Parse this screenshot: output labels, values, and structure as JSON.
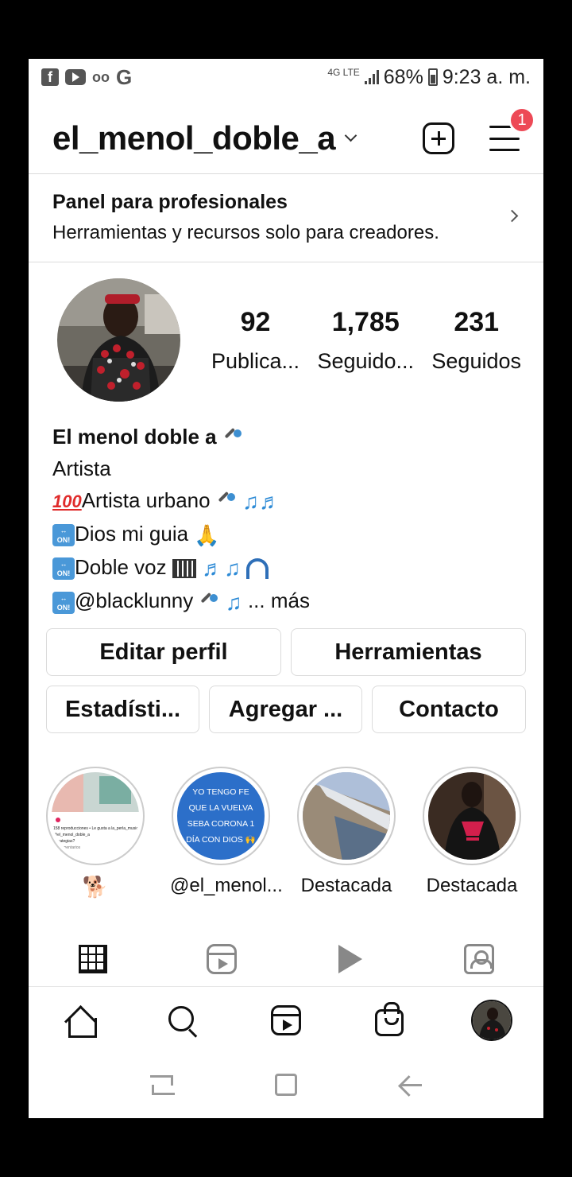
{
  "status_bar": {
    "network": "4G LTE",
    "battery": "68%",
    "time": "9:23 a. m."
  },
  "header": {
    "username": "el_menol_doble_a",
    "notification_count": "1"
  },
  "professional_panel": {
    "title": "Panel para profesionales",
    "subtitle": "Herramientas y recursos solo para creadores."
  },
  "stats": [
    {
      "value": "92",
      "label": "Publica..."
    },
    {
      "value": "1,785",
      "label": "Seguido..."
    },
    {
      "value": "231",
      "label": "Seguidos"
    }
  ],
  "bio": {
    "name": "El menol doble a",
    "category": "Artista",
    "line1": "Artista urbano",
    "line2": "Dios mi guia",
    "line3": "Doble voz",
    "line4": "@blacklunny",
    "more": "... más",
    "on_badge": "ON!"
  },
  "buttons": {
    "edit_profile": "Editar perfil",
    "tools": "Herramientas",
    "stats": "Estadísti...",
    "add": "Agregar ...",
    "contact": "Contacto"
  },
  "highlights": [
    {
      "label": ""
    },
    {
      "label": "@el_menol...",
      "image_text": "YO TENGO FE QUE LA VUELVA SEBA CORONA 1 DÍA CON DIOS 🙌"
    },
    {
      "label": "Destacada"
    },
    {
      "label": "Destacada"
    }
  ],
  "highlight_thumb_text": {
    "caption": "158 reproducciones • Le gusta a la_perla_music",
    "caption2": "@el_menol_doble_a",
    "caption3": "estrategias?",
    "caption4": "15 comentarios"
  },
  "colors": {
    "badge": "#ed4956",
    "emoji_blue": "#2e8bd6",
    "emoji_red": "#e02b2b"
  }
}
